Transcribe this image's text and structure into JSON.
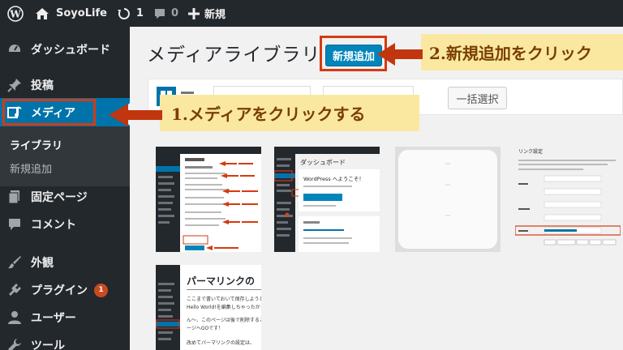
{
  "admin_bar": {
    "site_name": "SoyoLife",
    "updates_count": "1",
    "comments_count": "0",
    "new_label": "新規"
  },
  "sidebar": {
    "items": [
      {
        "label": "ダッシュボード",
        "icon": "dashboard-icon"
      },
      {
        "label": "投稿",
        "icon": "pin-icon"
      },
      {
        "label": "メディア",
        "icon": "media-icon"
      },
      {
        "label": "固定ページ",
        "icon": "page-icon"
      },
      {
        "label": "コメント",
        "icon": "comment-icon"
      },
      {
        "label": "外観",
        "icon": "brush-icon"
      },
      {
        "label": "プラグイン",
        "icon": "plugin-icon",
        "badge": "1"
      },
      {
        "label": "ユーザー",
        "icon": "user-icon"
      },
      {
        "label": "ツール",
        "icon": "wrench-icon"
      }
    ],
    "media_submenu": {
      "library": "ライブラリ",
      "add_new": "新規追加"
    }
  },
  "main": {
    "page_title": "メディアライブラリ",
    "add_new_button": "新規追加",
    "toolbar": {
      "bulk_select": "一括選択"
    },
    "thumbnail_texts": {
      "t5_heading": "パーマリンクの",
      "t5_line1": "ここまで書いておいて保存しようと",
      "t5_line2": "Hello World!を編集しちゃったから",
      "t5_line3": "ん〜、このページは後で削除するこ",
      "t5_line4": "ージへGOです！",
      "t5_line5": "改めてパーマリンクの設定は、",
      "t2_title": "ダッシュボード",
      "t2_welcome": "WordPress へようこそ！",
      "t4_title": "リンク設定"
    }
  },
  "annotations": {
    "step1": "1.メディアをクリックする",
    "step2": "2.新規追加をクリック"
  },
  "colors": {
    "admin_bg": "#23282d",
    "accent": "#0073aa",
    "button": "#0085ba",
    "callout_bg": "#fbe8a0",
    "highlight": "#d63a10",
    "badge": "#ca4a1f"
  }
}
